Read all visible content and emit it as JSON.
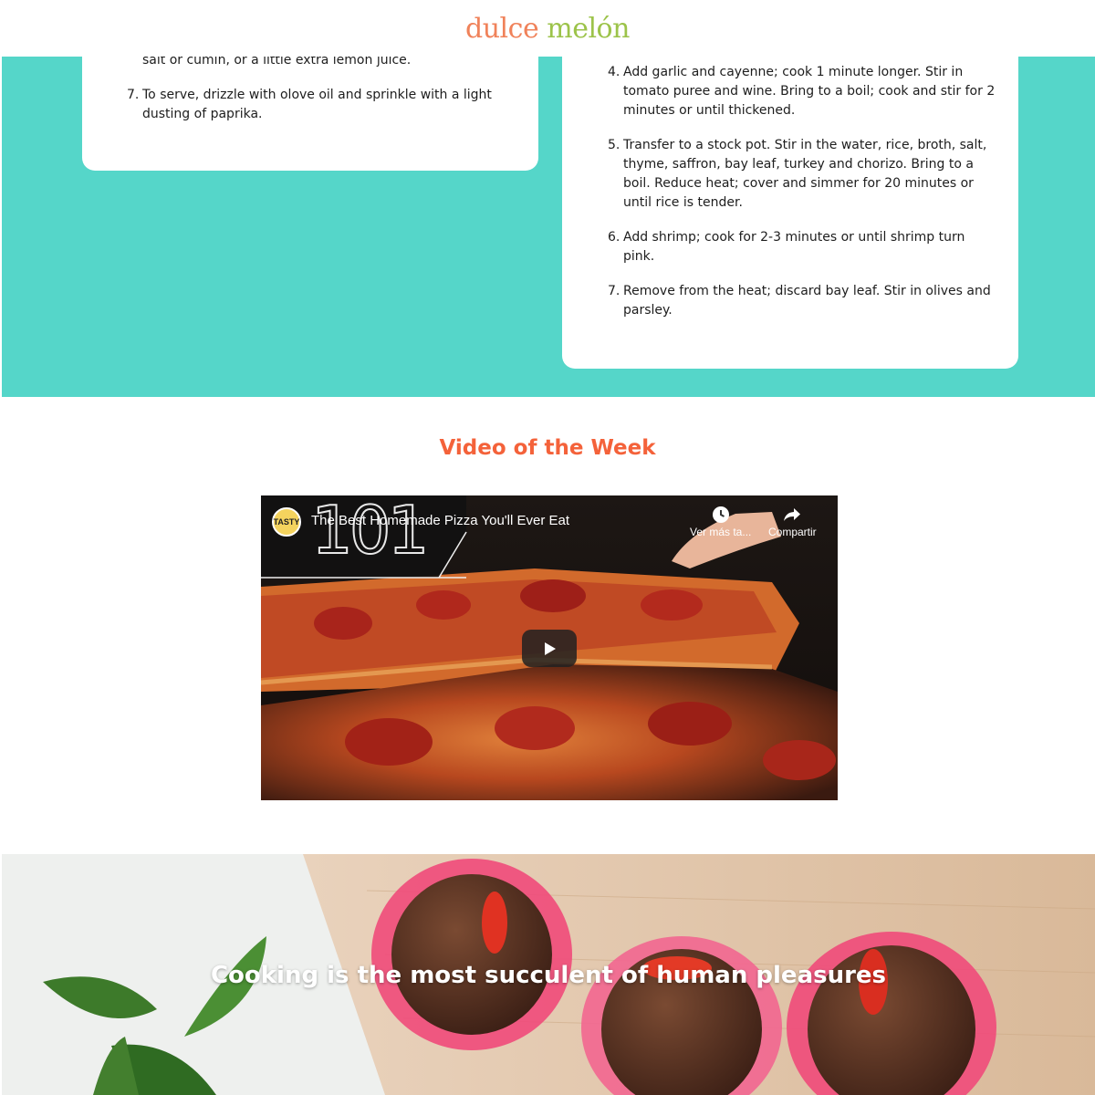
{
  "brand": {
    "word1": "dulce",
    "word2": "melón"
  },
  "left_card": {
    "steps": [
      {
        "num": "",
        "text": "salt or cumin, or a little extra lemon juice."
      },
      {
        "num": "7.",
        "text": "To serve, drizzle with olove oil and sprinkle with a light dusting of paprika."
      }
    ]
  },
  "right_card": {
    "steps": [
      {
        "num": "4.",
        "text": "Add garlic and cayenne; cook 1 minute longer. Stir in tomato puree and wine. Bring to a boil; cook and stir for 2 minutes or until thickened."
      },
      {
        "num": "5.",
        "text": "Transfer to a stock pot. Stir in the water, rice, broth, salt, thyme, saffron, bay leaf, turkey and chorizo. Bring to a boil. Reduce heat; cover and simmer for 20 minutes or until rice is tender."
      },
      {
        "num": "6.",
        "text": "Add shrimp; cook for 2-3 minutes or until shrimp turn pink."
      },
      {
        "num": "7.",
        "text": "Remove from the heat; discard bay leaf. Stir in olives and parsley."
      }
    ]
  },
  "video_section": {
    "title": "Video of the Week",
    "video": {
      "title": "The Best Homemade Pizza You'll Ever Eat",
      "channel_badge": "TASTY",
      "overlay_number": "101",
      "watch_later_label": "Ver más ta...",
      "share_label": "Compartir",
      "icons": {
        "watch_later": "clock-icon",
        "share": "share-icon",
        "play": "play-icon"
      }
    }
  },
  "hero": {
    "quote": "Cooking is the most succulent of human pleasures"
  },
  "colors": {
    "teal": "#55d6c9",
    "accent": "#f4623a",
    "logo_orange": "#f0825a",
    "logo_green": "#9cc34a"
  }
}
